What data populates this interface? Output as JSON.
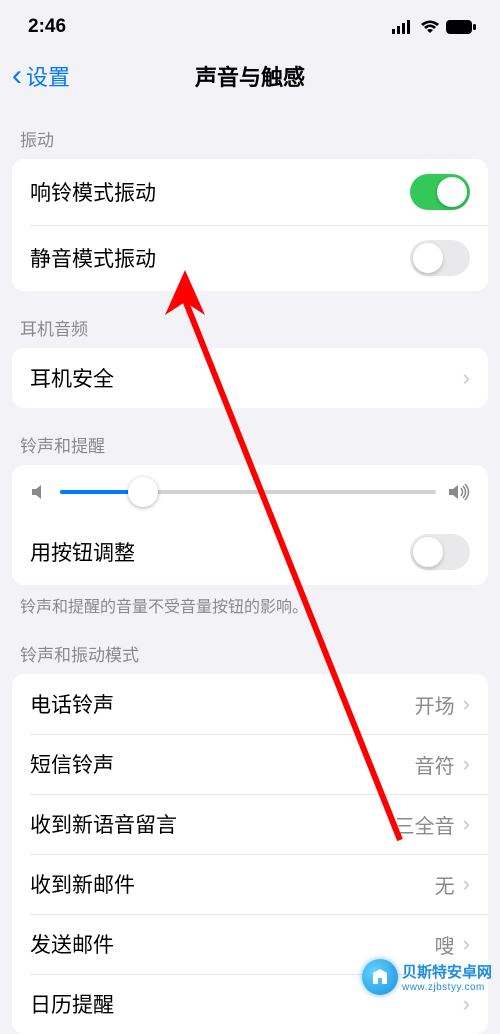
{
  "status": {
    "time": "2:46"
  },
  "nav": {
    "back": "设置",
    "title": "声音与触感"
  },
  "sections": {
    "vibration": {
      "header": "振动",
      "ring": "响铃模式振动",
      "silent": "静音模式振动"
    },
    "headphone": {
      "header": "耳机音频",
      "safety": "耳机安全"
    },
    "ringer": {
      "header": "铃声和提醒",
      "adjust_with_buttons": "用按钮调整",
      "note": "铃声和提醒的音量不受音量按钮的影响。",
      "slider_percent": 22
    },
    "patterns": {
      "header": "铃声和振动模式",
      "items": [
        {
          "label": "电话铃声",
          "value": "开场"
        },
        {
          "label": "短信铃声",
          "value": "音符"
        },
        {
          "label": "收到新语音留言",
          "value": "三全音"
        },
        {
          "label": "收到新邮件",
          "value": "无"
        },
        {
          "label": "发送邮件",
          "value": "嗖"
        },
        {
          "label": "日历提醒",
          "value": ""
        }
      ]
    }
  },
  "watermark": {
    "cn": "贝斯特安卓网",
    "en": "www.zjbstyy.com"
  }
}
